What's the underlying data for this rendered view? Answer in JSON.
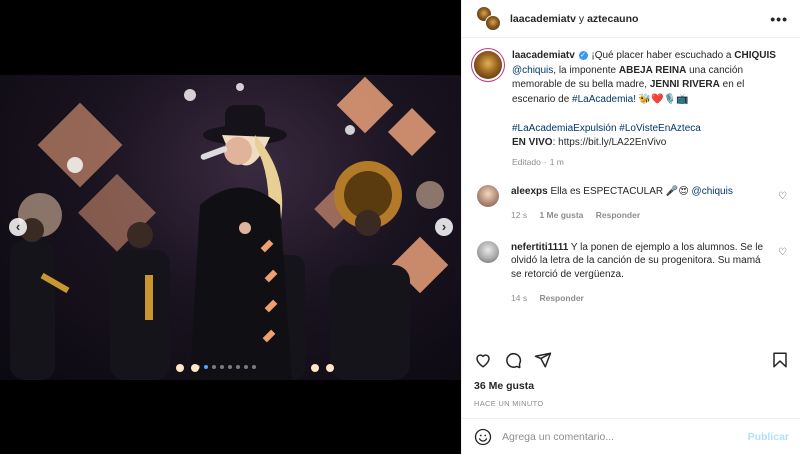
{
  "header": {
    "account_1": "laacademiatv",
    "joiner": "y",
    "account_2": "aztecauno",
    "more_icon": "more-horizontal-icon"
  },
  "caption": {
    "username": "laacademiatv",
    "text_1": "¡Qué placer haber escuchado a ",
    "bold_1": "CHIQUIS",
    "mention_1": "@chiquis",
    "text_2": ", la imponente ",
    "bold_2": "ABEJA REINA",
    "text_3": " una canción memorable de su bella madre, ",
    "bold_3": "JENNI RIVERA",
    "text_4": " en el escenario de ",
    "hashtag_1": "#LaAcademia",
    "text_5": "! 🐝❤️🎙️📺",
    "hashtag_2": "#LaAcademiaExpulsión",
    "hashtag_3": "#LoVisteEnAzteca",
    "live_label": "EN VIVO",
    "live_url": ": https://bit.ly/LA22EnVivo",
    "edited": "Editado",
    "sep": "·",
    "age": "1 m"
  },
  "comments": [
    {
      "username": "aleexps",
      "text": "Ella es ESPECTACULAR 🎤😍 ",
      "mention": "@chiquis",
      "age": "12 s",
      "likes": "1 Me gusta",
      "reply": "Responder"
    },
    {
      "username": "nefertiti1111",
      "text": "Y la ponen de ejemplo a los alumnos. Se le olvidó la letra de la canción de su progenitora. Su mamá se retorció de vergüenza.",
      "age": "14 s",
      "reply": "Responder"
    }
  ],
  "footer": {
    "likes": "36 Me gusta",
    "timestamp": "HACE UN MINUTO",
    "comment_placeholder": "Agrega un comentario...",
    "publish": "Publicar"
  },
  "media": {
    "carousel_dots": 8,
    "active_dot": 1,
    "prev": "‹",
    "next": "›"
  }
}
